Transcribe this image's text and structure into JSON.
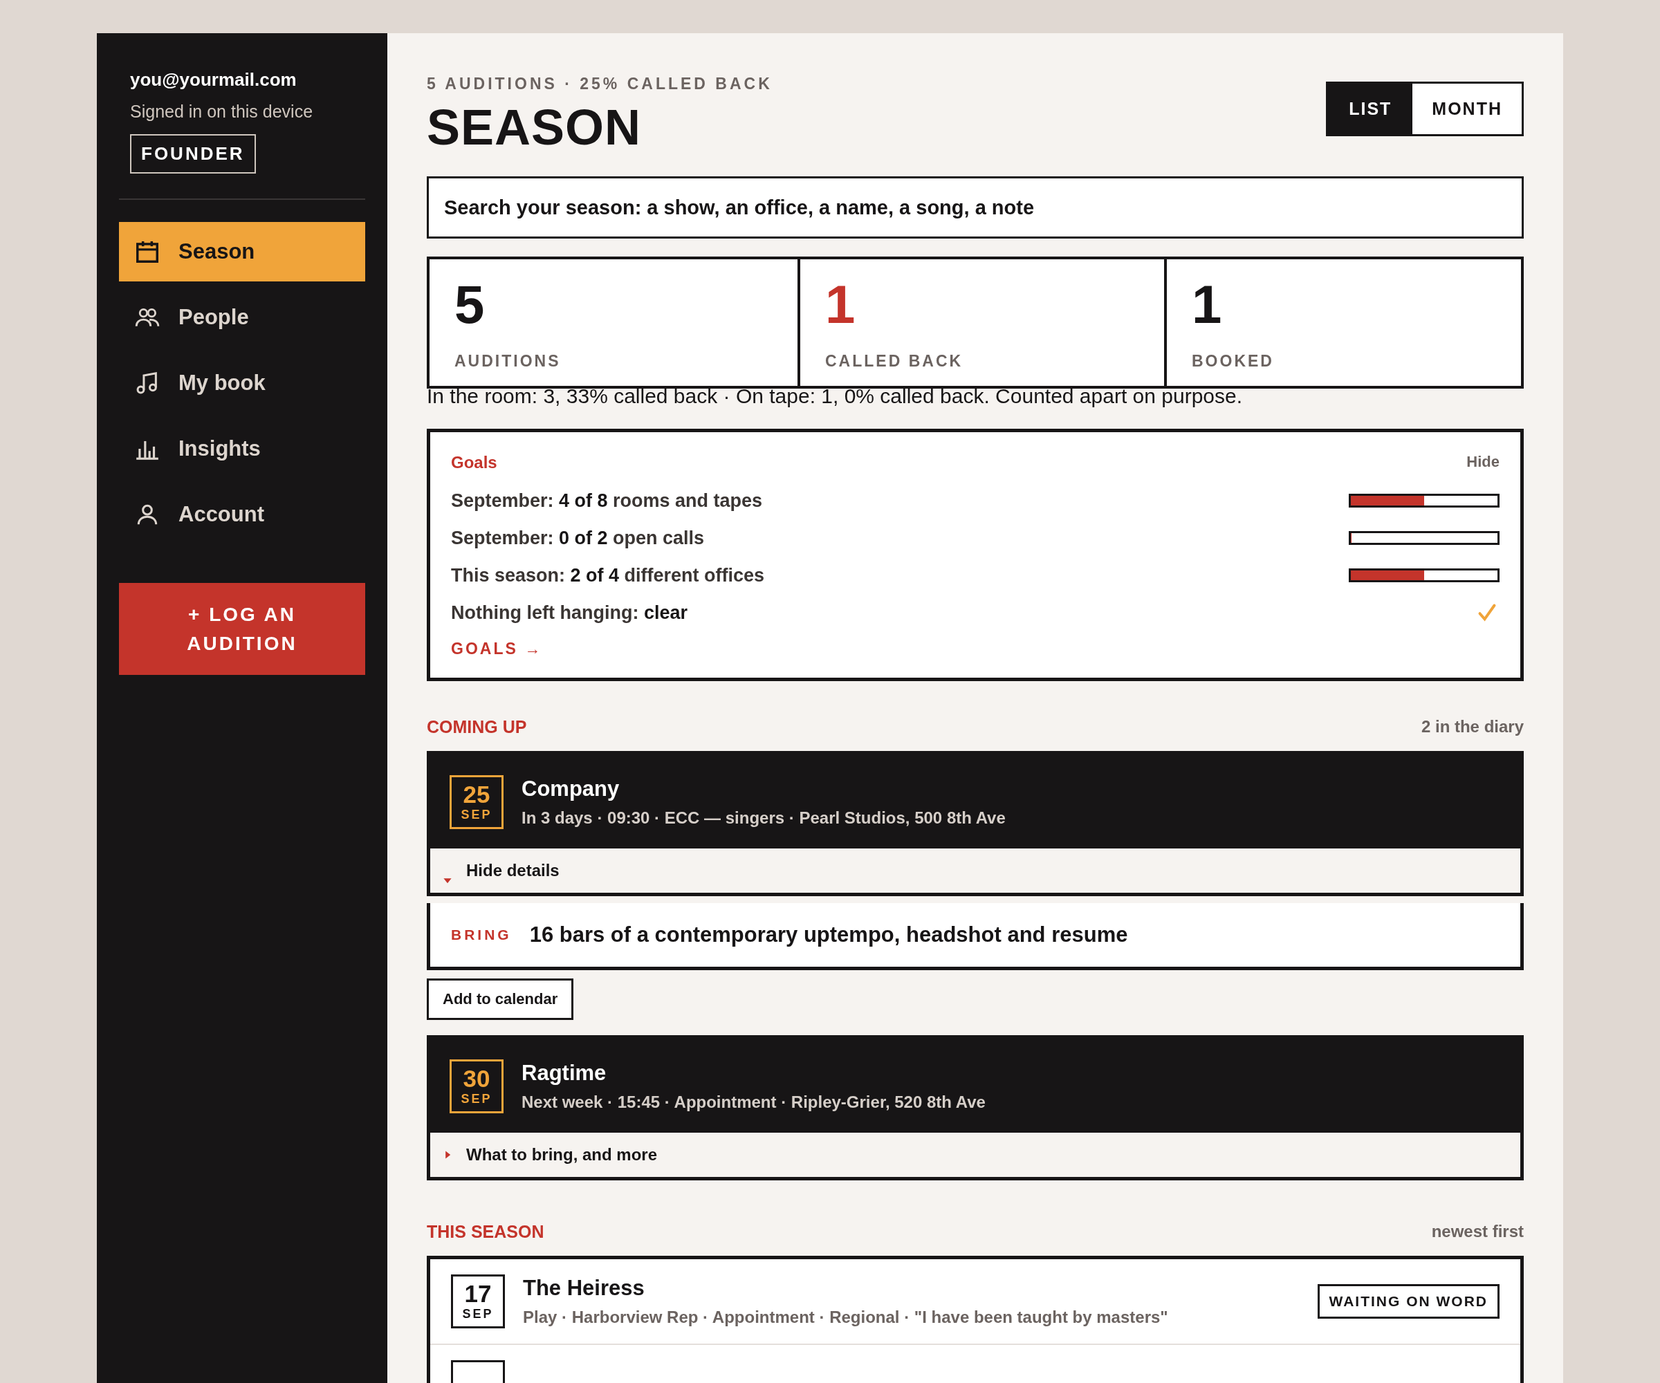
{
  "sidebar": {
    "email": "you@yourmail.com",
    "status": "Signed in on this device",
    "badge": "FOUNDER",
    "nav": [
      {
        "label": "Season",
        "selected": true
      },
      {
        "label": "People",
        "selected": false
      },
      {
        "label": "My book",
        "selected": false
      },
      {
        "label": "Insights",
        "selected": false
      },
      {
        "label": "Account",
        "selected": false
      }
    ],
    "action_button": "+ LOG AN AUDITION"
  },
  "header": {
    "eyebrow": "5 AUDITIONS · 25% CALLED BACK",
    "title": "SEASON",
    "view_toggle": [
      {
        "label": "LIST",
        "selected": true
      },
      {
        "label": "MONTH",
        "selected": false
      }
    ]
  },
  "search": {
    "placeholder": "Search your season: a show, an office, a name, a song, a note"
  },
  "stats": [
    {
      "value": "5",
      "label": "AUDITIONS",
      "color": "#171516"
    },
    {
      "value": "1",
      "label": "CALLED BACK",
      "color": "#c4342b"
    },
    {
      "value": "1",
      "label": "BOOKED",
      "color": "#171516"
    }
  ],
  "note": "In the room: 3, 33% called back · On tape: 1, 0% called back. Counted apart on purpose.",
  "goals": {
    "title": "Goals",
    "hide": "Hide",
    "items": [
      {
        "kind": "bar",
        "text": "September: **4 of 8** rooms and tapes",
        "level": 0.5
      },
      {
        "kind": "bar",
        "text": "September: **0 of 2** open calls",
        "level": 0
      },
      {
        "kind": "bar",
        "text": "This season: **2 of 4** different offices",
        "level": 0.5
      },
      {
        "kind": "check",
        "text": "Nothing left hanging: **clear**"
      }
    ],
    "link": "GOALS →"
  },
  "coming_up": {
    "title": "COMING UP",
    "count": "2 in the diary",
    "events": [
      {
        "day": "25",
        "month": "SEP",
        "title": "Company",
        "meta": "In 3 days · 09:30 · ECC — singers · Pearl Studios, 500 8th Ave",
        "expanded": true,
        "toggle": "Hide details",
        "bring_label": "BRING",
        "bring_text": "16 bars of a contemporary uptempo, headshot and resume",
        "action": "Add to calendar"
      },
      {
        "day": "30",
        "month": "SEP",
        "title": "Ragtime",
        "meta": "Next week · 15:45 · Appointment · Ripley-Grier, 520 8th Ave",
        "expanded": false,
        "toggle": "What to bring, and more"
      }
    ]
  },
  "this_season": {
    "title": "THIS SEASON",
    "sort": "newest first",
    "entries": [
      {
        "day": "17",
        "month": "SEP",
        "title": "The Heiress",
        "meta": "Play · Harborview Rep · Appointment · Regional · \"I have been taught by masters\"",
        "status": "WAITING ON WORD"
      }
    ]
  }
}
